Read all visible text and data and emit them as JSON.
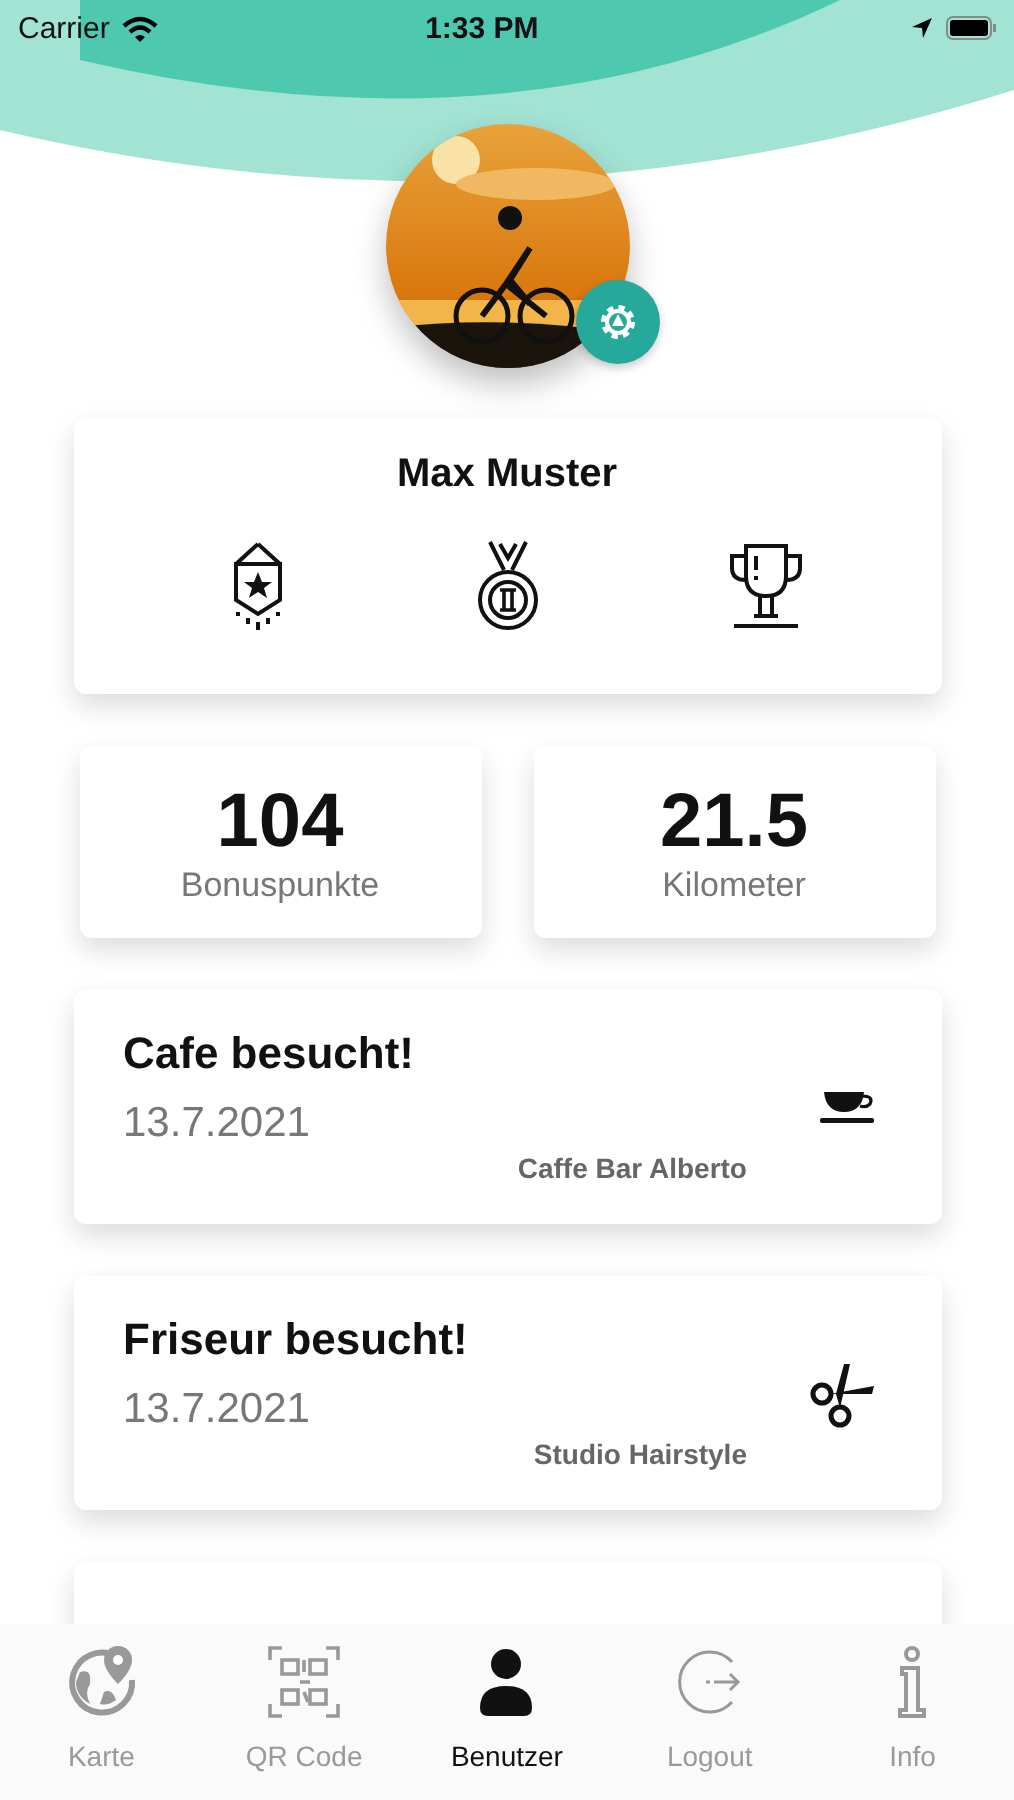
{
  "status_bar": {
    "carrier": "Carrier",
    "time": "1:33 PM"
  },
  "profile": {
    "name": "Max Muster",
    "badges": [
      {
        "kind": "pennant"
      },
      {
        "kind": "medal"
      },
      {
        "kind": "trophy"
      }
    ]
  },
  "stats": [
    {
      "value": "104",
      "label": "Bonuspunkte"
    },
    {
      "value": "21.5",
      "label": "Kilometer"
    }
  ],
  "activities": [
    {
      "title": "Cafe besucht!",
      "date": "13.7.2021",
      "place": "Caffe Bar Alberto",
      "kind": "cafe"
    },
    {
      "title": "Friseur besucht!",
      "date": "13.7.2021",
      "place": "Studio Hairstyle",
      "kind": "hair"
    }
  ],
  "tabs": [
    {
      "label": "Karte",
      "kind": "map",
      "selected": false
    },
    {
      "label": "QR Code",
      "kind": "qr",
      "selected": false
    },
    {
      "label": "Benutzer",
      "kind": "user",
      "selected": true
    },
    {
      "label": "Logout",
      "kind": "logout",
      "selected": false
    },
    {
      "label": "Info",
      "kind": "info",
      "selected": false
    }
  ]
}
